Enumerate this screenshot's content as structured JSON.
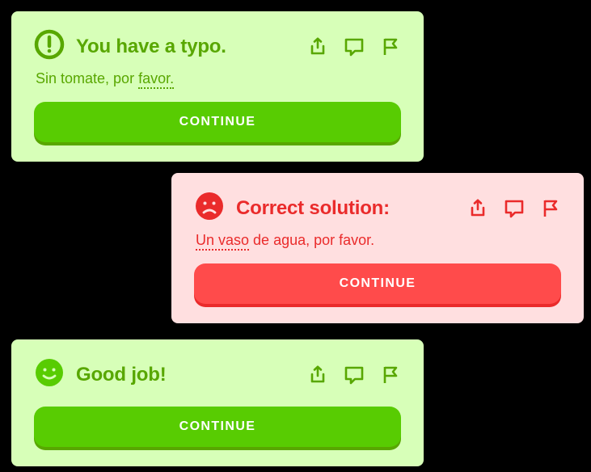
{
  "cards": [
    {
      "title": "You have a typo.",
      "solution_pre": "Sin tomate, por ",
      "solution_u": "favor.",
      "solution_post": "",
      "button": "CONTINUE",
      "colors": {
        "accent": "#58a700",
        "bg": "#d7ffb8",
        "button": "#58cc02"
      },
      "icon": "exclamation-circle"
    },
    {
      "title": "Correct solution:",
      "solution_pre": "",
      "solution_u": "Un vaso",
      "solution_post": " de agua, por favor.",
      "button": "CONTINUE",
      "colors": {
        "accent": "#ea2b2b",
        "bg": "#ffdfe0",
        "button": "#ff4b4b"
      },
      "icon": "frown-face"
    },
    {
      "title": "Good job!",
      "solution_pre": "",
      "solution_u": "",
      "solution_post": "",
      "button": "CONTINUE",
      "colors": {
        "accent": "#58a700",
        "bg": "#d7ffb8",
        "button": "#58cc02"
      },
      "icon": "smile-face"
    }
  ],
  "action_icons": [
    "share-icon",
    "comment-icon",
    "flag-icon"
  ]
}
